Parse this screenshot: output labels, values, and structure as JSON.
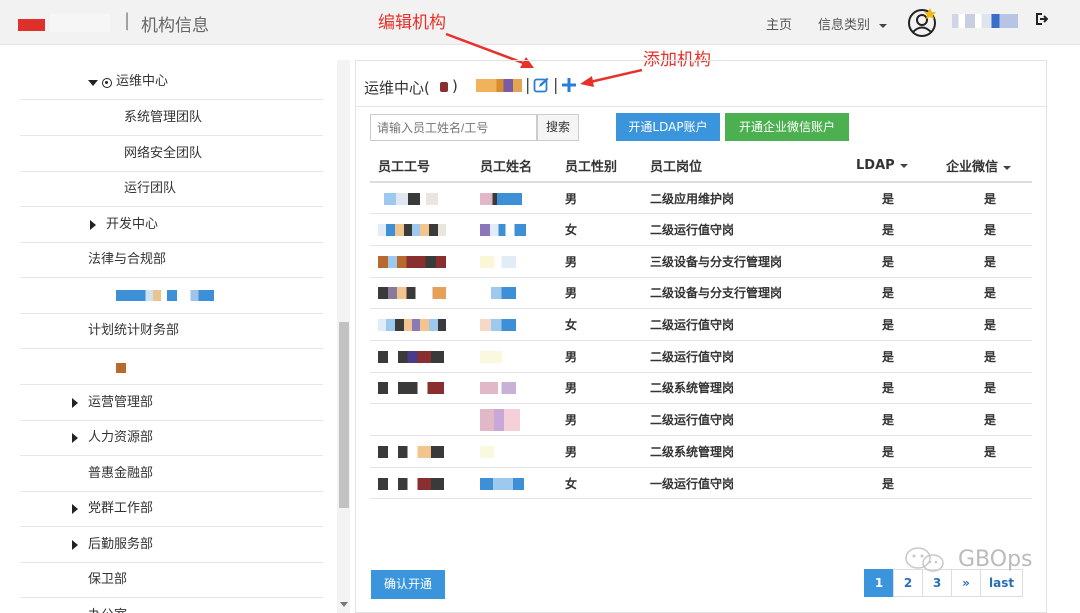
{
  "header": {
    "title": "机构信息",
    "divider": "|",
    "nav_home": "主页",
    "nav_info": "信息类别"
  },
  "annotations": {
    "edit_org": "编辑机构",
    "add_org": "添加机构"
  },
  "sidebar": {
    "items": [
      {
        "label": "运维中心",
        "level": 1,
        "expanded": true,
        "selected": true
      },
      {
        "label": "系统管理团队",
        "level": 2
      },
      {
        "label": "网络安全团队",
        "level": 2
      },
      {
        "label": "运行团队",
        "level": 2
      },
      {
        "label": "开发中心",
        "level": 1,
        "expandable": true
      },
      {
        "label": "法律与合规部",
        "level": 0
      },
      {
        "label": "",
        "level": 0
      },
      {
        "label": "计划统计财务部",
        "level": 0
      },
      {
        "label": "",
        "level": 0
      },
      {
        "label": "运营管理部",
        "level": 0,
        "expandable": true
      },
      {
        "label": "人力资源部",
        "level": 0,
        "expandable": true
      },
      {
        "label": "普惠金融部",
        "level": 0
      },
      {
        "label": "党群工作部",
        "level": 0,
        "expandable": true
      },
      {
        "label": "后勤服务部",
        "level": 0,
        "expandable": true
      },
      {
        "label": "保卫部",
        "level": 0
      },
      {
        "label": "办公室",
        "level": 0
      }
    ]
  },
  "panel": {
    "org_name": "运维中心(",
    "org_paren": ")",
    "sep": "|",
    "search_placeholder": "请输入员工姓名/工号",
    "search_button": "搜索",
    "ldap_button": "开通LDAP账户",
    "wechat_button": "开通企业微信账户",
    "confirm_button": "确认开通"
  },
  "table": {
    "headers": [
      "员工工号",
      "员工姓名",
      "员工性别",
      "员工岗位",
      "LDAP",
      "企业微信"
    ],
    "rows": [
      {
        "sex": "男",
        "post": "二级应用维护岗",
        "ldap": "是",
        "wechat": "是"
      },
      {
        "sex": "女",
        "post": "二级运行值守岗",
        "ldap": "是",
        "wechat": "是"
      },
      {
        "sex": "男",
        "post": "三级设备与分支行管理岗",
        "ldap": "是",
        "wechat": "是"
      },
      {
        "sex": "男",
        "post": "二级设备与分支行管理岗",
        "ldap": "是",
        "wechat": "是"
      },
      {
        "sex": "女",
        "post": "二级运行值守岗",
        "ldap": "是",
        "wechat": "是"
      },
      {
        "sex": "男",
        "post": "二级运行值守岗",
        "ldap": "是",
        "wechat": "是"
      },
      {
        "sex": "男",
        "post": "二级系统管理岗",
        "ldap": "是",
        "wechat": "是"
      },
      {
        "sex": "男",
        "post": "二级运行值守岗",
        "ldap": "是",
        "wechat": "是"
      },
      {
        "sex": "男",
        "post": "二级系统管理岗",
        "ldap": "是",
        "wechat": "是"
      },
      {
        "sex": "女",
        "post": "一级运行值守岗",
        "ldap": "是",
        "wechat": ""
      }
    ]
  },
  "pager": {
    "pages": [
      "1",
      "2",
      "3",
      "»",
      "last"
    ],
    "active": "1"
  },
  "watermark": "GBOps",
  "colors": {
    "primary": "#3b95dc",
    "success": "#4cb051",
    "annotation": "#e8312a"
  }
}
